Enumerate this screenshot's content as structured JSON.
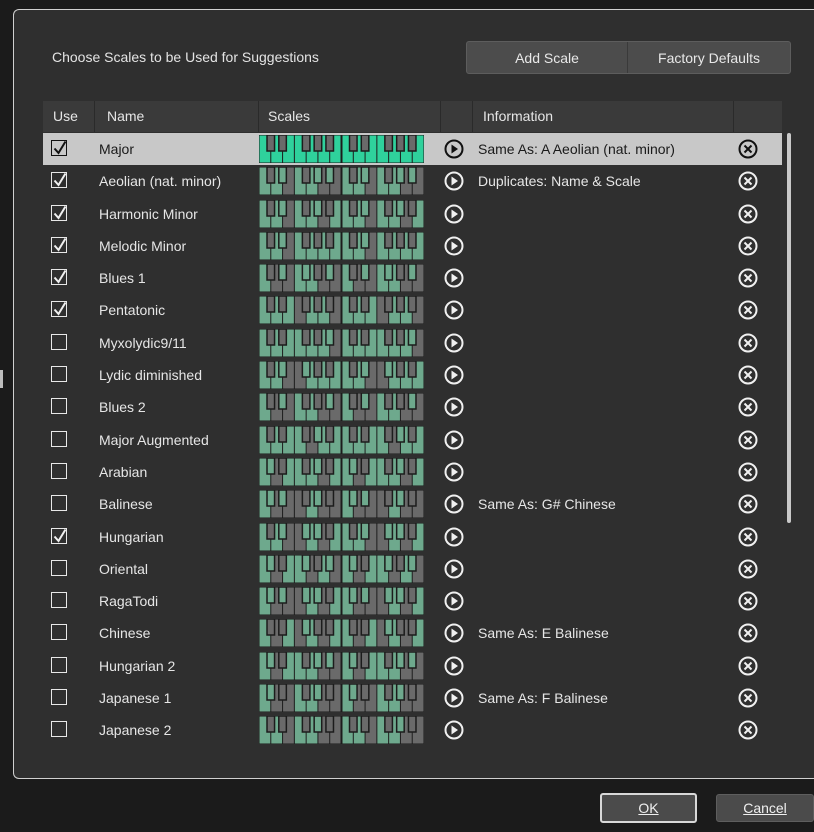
{
  "dialog": {
    "heading": "Choose Scales to be Used for Suggestions",
    "add_scale_label": "Add Scale",
    "factory_defaults_label": "Factory Defaults",
    "ok_label": "OK",
    "cancel_label": "Cancel"
  },
  "table": {
    "columns": [
      "Use",
      "Name",
      "Scales",
      "",
      "Information",
      ""
    ],
    "selected_row": 0,
    "rows": [
      {
        "use": true,
        "name": "Major",
        "info": "Same As:  A Aeolian (nat. minor)",
        "scale": [
          0,
          2,
          4,
          5,
          7,
          9,
          11
        ]
      },
      {
        "use": true,
        "name": "Aeolian (nat. minor)",
        "info": "Duplicates: Name & Scale",
        "scale": [
          0,
          2,
          3,
          5,
          7,
          8,
          10
        ]
      },
      {
        "use": true,
        "name": "Harmonic Minor",
        "info": "",
        "scale": [
          0,
          2,
          3,
          5,
          7,
          8,
          11
        ]
      },
      {
        "use": true,
        "name": "Melodic Minor",
        "info": "",
        "scale": [
          0,
          2,
          3,
          5,
          7,
          9,
          11
        ]
      },
      {
        "use": true,
        "name": "Blues 1",
        "info": "",
        "scale": [
          0,
          3,
          5,
          6,
          7,
          10
        ]
      },
      {
        "use": true,
        "name": "Pentatonic",
        "info": "",
        "scale": [
          0,
          2,
          4,
          7,
          9
        ]
      },
      {
        "use": false,
        "name": "Myxolydic9/11",
        "info": "",
        "scale": [
          0,
          2,
          4,
          5,
          7,
          9,
          10
        ]
      },
      {
        "use": false,
        "name": "Lydic diminished",
        "info": "",
        "scale": [
          0,
          2,
          3,
          6,
          7,
          9,
          11
        ]
      },
      {
        "use": false,
        "name": "Blues 2",
        "info": "",
        "scale": [
          0,
          3,
          5,
          7,
          10
        ]
      },
      {
        "use": false,
        "name": "Major Augmented",
        "info": "",
        "scale": [
          0,
          2,
          4,
          5,
          8,
          9,
          11
        ]
      },
      {
        "use": false,
        "name": "Arabian",
        "info": "",
        "scale": [
          0,
          1,
          4,
          5,
          7,
          8,
          11
        ]
      },
      {
        "use": false,
        "name": "Balinese",
        "info": "Same As:  G# Chinese",
        "scale": [
          0,
          1,
          3,
          7,
          8
        ]
      },
      {
        "use": true,
        "name": "Hungarian",
        "info": "",
        "scale": [
          0,
          2,
          3,
          6,
          7,
          8,
          11
        ]
      },
      {
        "use": false,
        "name": "Oriental",
        "info": "",
        "scale": [
          0,
          1,
          4,
          5,
          6,
          9,
          10
        ]
      },
      {
        "use": false,
        "name": "RagaTodi",
        "info": "",
        "scale": [
          0,
          1,
          3,
          6,
          7,
          8,
          11
        ]
      },
      {
        "use": false,
        "name": "Chinese",
        "info": "Same As:  E Balinese",
        "scale": [
          0,
          4,
          6,
          7,
          11
        ]
      },
      {
        "use": false,
        "name": "Hungarian 2",
        "info": "",
        "scale": [
          0,
          1,
          4,
          5,
          7,
          8,
          10
        ]
      },
      {
        "use": false,
        "name": "Japanese 1",
        "info": "Same As:  F Balinese",
        "scale": [
          0,
          1,
          5,
          7,
          8
        ]
      },
      {
        "use": false,
        "name": "Japanese 2",
        "info": "",
        "scale": [
          0,
          2,
          5,
          7,
          8
        ]
      }
    ]
  },
  "colors": {
    "active_key": "#2fd19c",
    "scale_key": "#6ea98d",
    "inactive_key": "#6a6a6a",
    "selected_row": "#c8c8c8"
  },
  "icons": {
    "play": "play-circle-icon",
    "delete": "delete-circle-x-icon",
    "check": "checkmark-icon"
  }
}
